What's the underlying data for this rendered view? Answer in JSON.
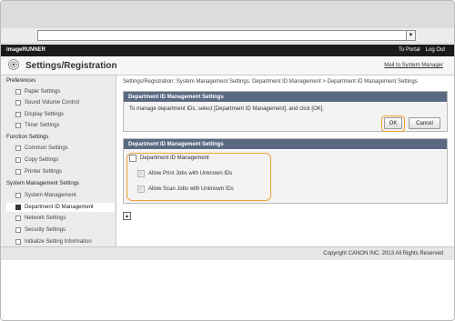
{
  "brand": "imageRUNNER",
  "top_links": {
    "portal": "To Portal",
    "logout": "Log Out"
  },
  "page_title": "Settings/Registration",
  "mail_link": "Mail to System Manager",
  "sidebar": {
    "preferences": {
      "heading": "Preferences",
      "items": [
        "Paper Settings",
        "Sound Volume Control",
        "Display Settings",
        "Timer Settings"
      ]
    },
    "function": {
      "heading": "Function Settings",
      "items": [
        "Common Settings",
        "Copy Settings",
        "Printer Settings"
      ]
    },
    "system": {
      "heading": "System Management Settings",
      "items": [
        "System Management",
        "Department ID Management",
        "Network Settings",
        "Security Settings",
        "Initialize Setting Information"
      ]
    }
  },
  "breadcrumb": "Settings/Registration: System Management Settings: Department ID Management > Department ID Management Settings",
  "panel1": {
    "header": "Department ID Management Settings",
    "message": "To manage department IDs, select [Department ID Management], and click [OK].",
    "ok": "OK",
    "cancel": "Cancel"
  },
  "panel2": {
    "header": "Department ID Management Settings",
    "dept_id_management": "Department ID Management",
    "allow_print": "Allow Print Jobs with Unknown IDs",
    "allow_scan": "Allow Scan Jobs with Unknown IDs"
  },
  "footer": "Copyright CANON INC. 2013 All Rights Reserved",
  "colors": {
    "accent_ring": "#f0a030",
    "panel_header": "#5a6a82",
    "brand_bar": "#1b1b1b"
  }
}
